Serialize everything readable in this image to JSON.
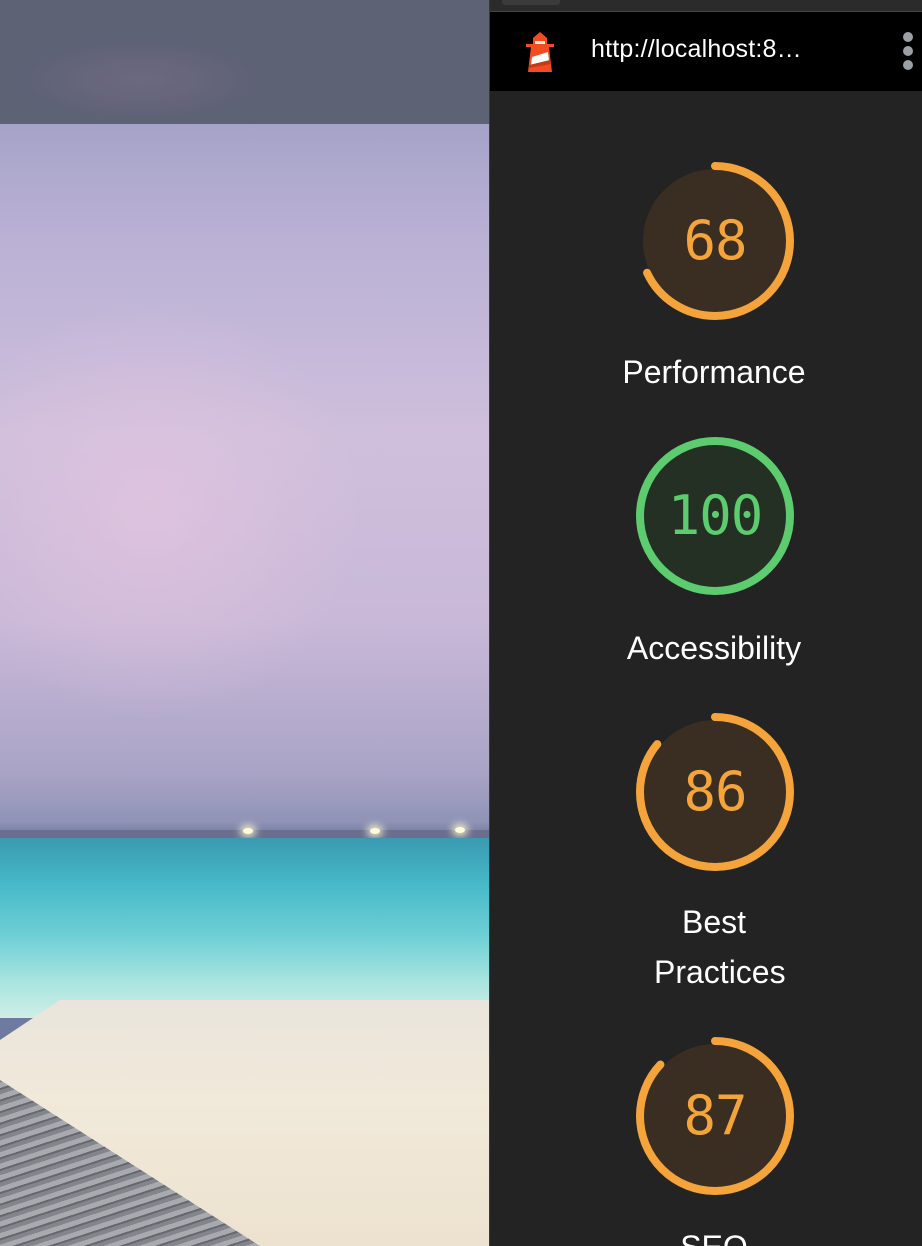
{
  "toolbar": {
    "url": "http://localhost:8…",
    "menu_icon": "more-vertical-icon",
    "app_icon": "lighthouse-icon"
  },
  "colors": {
    "average": "#f4a43a",
    "average_bg": "#3a2e22",
    "pass": "#5ccc6e",
    "pass_bg": "#243024",
    "panel_bg": "#232323"
  },
  "scores": [
    {
      "category": "Performance",
      "score": "68",
      "fraction": 0.68,
      "rating": "average"
    },
    {
      "category": "Accessibility",
      "score": "100",
      "fraction": 1.0,
      "rating": "pass"
    },
    {
      "category": "Best Practices",
      "score": "86",
      "fraction": 0.86,
      "rating": "average"
    },
    {
      "category": "SEO",
      "score": "87",
      "fraction": 0.87,
      "rating": "average"
    }
  ]
}
